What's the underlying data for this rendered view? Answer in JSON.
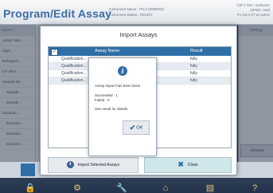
{
  "app": {
    "title": "Program/Edit Assay",
    "instrument_name": "Instrument Name : IPLX (IMBER9)",
    "instrument_status": "Instrument Status : READY",
    "user_line1": "Ctrl°s /OK / Software",
    "user_line2": "QPMX. read",
    "user_line3": "F1.X6.0.4T  w/ active"
  },
  "left_panel": {
    "header": "Save A...",
    "rows": [
      "Assay Nam...",
      "Oper...",
      "Refurgent...",
      "LIT Allen...",
      "Sample Nu...",
      "Sample...",
      "Sample...",
      "Extractio...",
      "Extractio...",
      "Extractio...",
      "Extractio..."
    ]
  },
  "right_panel": {
    "header": "Settings",
    "button": "All Done"
  },
  "dialog": {
    "title": "Import Assays",
    "columns": {
      "name": "Assay Name",
      "result": "Result"
    },
    "rows": [
      {
        "name": "Qualification...",
        "result": "fully"
      },
      {
        "name": "Qualification...",
        "result": "fully"
      },
      {
        "name": "Qualification...",
        "result": "fully"
      },
      {
        "name": "Qualification...",
        "result": "fully"
      }
    ],
    "import_button": "Import Selected Assays",
    "close_button": "Close"
  },
  "message": {
    "line1": "Assay import has been done.",
    "succeeded": "Succeeded : 1",
    "failed": "Failed : 0",
    "see_result": "See result for details.",
    "ok": "OK"
  },
  "footer": {
    "icons": [
      "lock-icon",
      "gear-icon",
      "wrench-icon",
      "home-icon",
      "document-icon",
      "help-icon"
    ]
  }
}
